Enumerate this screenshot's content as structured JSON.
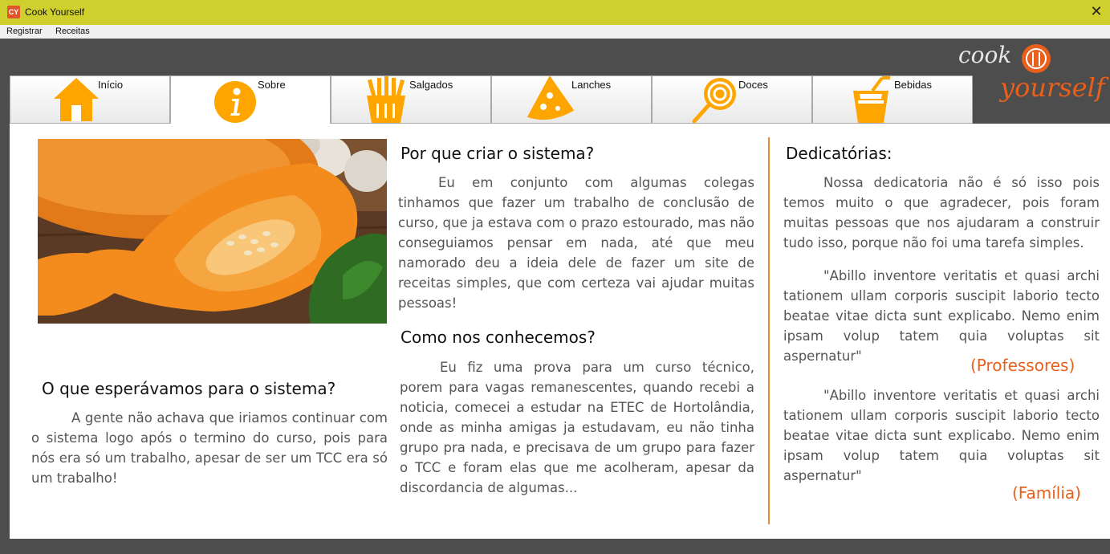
{
  "window": {
    "title": "Cook Yourself",
    "icon_text": "CY",
    "close_glyph": "✕"
  },
  "menu": {
    "items": [
      "Registrar",
      "Receitas"
    ]
  },
  "tabs": [
    {
      "label": "Início",
      "icon": "house-icon"
    },
    {
      "label": "Sobre",
      "icon": "info-icon"
    },
    {
      "label": "Salgados",
      "icon": "fries-icon"
    },
    {
      "label": "Lanches",
      "icon": "pizza-icon"
    },
    {
      "label": "Doces",
      "icon": "lollipop-icon"
    },
    {
      "label": "Bebidas",
      "icon": "drink-icon"
    }
  ],
  "logo": {
    "line1": "cook",
    "line2": "yourself"
  },
  "colors": {
    "accent": "#ffa500",
    "brand": "#e8601c",
    "titlebar": "#cfcf2d",
    "background": "#4d4d4d"
  },
  "sections": {
    "why": {
      "title": "Por que criar o sistema?",
      "body": "Eu em conjunto com algumas colegas tinhamos que fazer um trabalho de conclusão de curso, que ja estava com o prazo estourado, mas não conseguiamos pensar em nada, até que meu namorado deu a ideia dele de fazer um site de receitas simples, que com certeza vai ajudar muitas pessoas!"
    },
    "how_met": {
      "title": "Como nos conhecemos?",
      "body": "Eu fiz uma prova para um curso técnico, porem para vagas remanescentes, quando recebi a noticia, comecei a estudar na ETEC de Hortolândia, onde as minha amigas ja estudavam, eu não tinha grupo pra nada, e precisava de um grupo para fazer o TCC e foram elas que me acolheram, apesar da discordancia de algumas..."
    },
    "expected": {
      "title": "O que esperávamos para o sistema?",
      "body": "A gente não achava que iriamos continuar com o sistema logo após o termino do curso, pois para nós era só um trabalho, apesar de ser um TCC era só um trabalho!"
    },
    "dedications": {
      "title": "Dedicatórias:",
      "intro": "Nossa dedicatoria não é só isso pois temos muito o que agradecer, pois foram muitas pessoas que nos ajudaram a construir tudo isso, porque não foi uma tarefa simples.",
      "quote1": "\"Abillo inventore veritatis et quasi archi tationem ullam corporis suscipit laborio tecto beatae vitae dicta sunt explicabo. Nemo enim ipsam volup tatem quia voluptas sit aspernatur\"",
      "sig1": "(Professores)",
      "quote2": "\"Abillo inventore veritatis et quasi archi tationem ullam corporis suscipit laborio tecto beatae vitae dicta sunt explicabo. Nemo enim ipsam volup tatem quia voluptas sit aspernatur\"",
      "sig2": "(Família)"
    }
  }
}
